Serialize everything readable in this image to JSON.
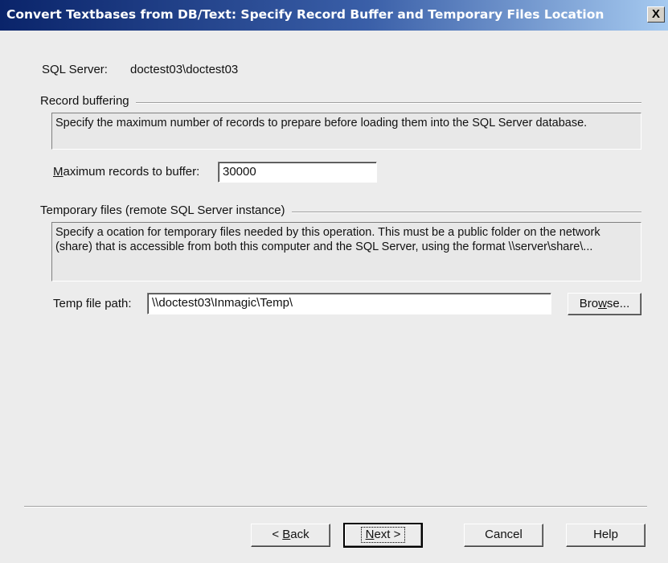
{
  "window": {
    "title": "Convert Textbases from DB/Text: Specify Record Buffer and Temporary Files Location",
    "close_glyph": "X"
  },
  "server": {
    "label": "SQL Server:",
    "value": "doctest03\\doctest03"
  },
  "record_buffering": {
    "group_title": "Record buffering",
    "description": "Specify the maximum number of records to prepare before loading them into the SQL Server database.",
    "max_label_mnemonic": "M",
    "max_label_rest": "aximum records to buffer:",
    "max_value": "30000"
  },
  "temp_files": {
    "group_title": "Temporary files (remote SQL Server instance)",
    "description": "Specify a ocation for temporary files needed by this operation. This must be a public folder on the network (share) that is accessible from both this computer and the SQL Server, using the format \\\\server\\share\\...",
    "path_label": "Temp file path:",
    "path_value": "\\\\doctest03\\Inmagic\\Temp\\",
    "browse_mnemonic": "w",
    "browse_pre": "Bro",
    "browse_post": "se..."
  },
  "buttons": {
    "back_prefix": "< ",
    "back_mnemonic": "B",
    "back_rest": "ack",
    "next_mnemonic": "N",
    "next_rest": "ext >",
    "cancel": "Cancel",
    "help": "Help"
  }
}
